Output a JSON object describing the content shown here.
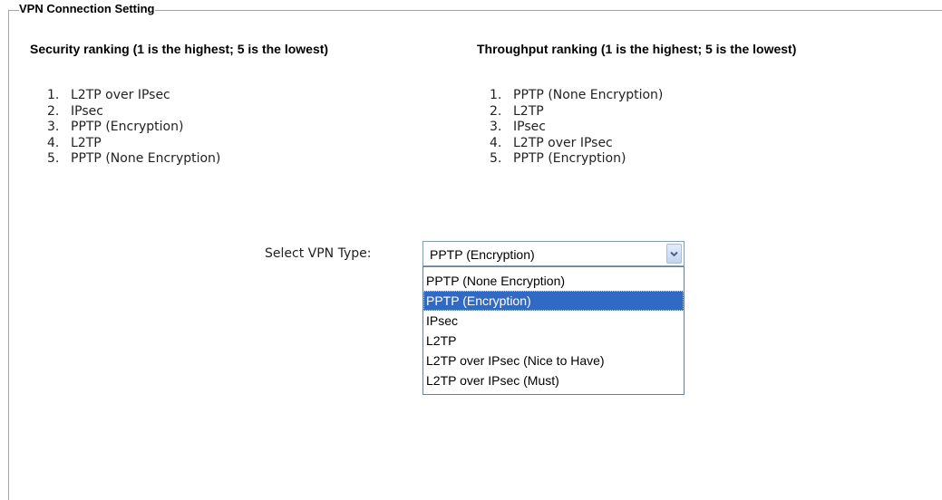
{
  "section": {
    "title": "VPN Connection Setting"
  },
  "security_ranking": {
    "heading": "Security ranking (1 is the highest; 5 is the lowest)",
    "items": [
      {
        "num": "1.",
        "label": "L2TP over IPsec"
      },
      {
        "num": "2.",
        "label": "IPsec"
      },
      {
        "num": "3.",
        "label": "PPTP (Encryption)"
      },
      {
        "num": "4.",
        "label": "L2TP"
      },
      {
        "num": "5.",
        "label": "PPTP (None Encryption)"
      }
    ]
  },
  "throughput_ranking": {
    "heading": "Throughput ranking (1 is the highest; 5 is the lowest)",
    "items": [
      {
        "num": "1.",
        "label": "PPTP (None Encryption)"
      },
      {
        "num": "2.",
        "label": "L2TP"
      },
      {
        "num": "3.",
        "label": "IPsec"
      },
      {
        "num": "4.",
        "label": "L2TP over IPsec"
      },
      {
        "num": "5.",
        "label": "PPTP (Encryption)"
      }
    ]
  },
  "vpn_select": {
    "label": "Select VPN Type:",
    "selected_value": "PPTP (Encryption)",
    "arrow_icon": "chevron-down-icon",
    "options": [
      "PPTP (None Encryption)",
      "PPTP (Encryption)",
      "IPsec",
      "L2TP",
      "L2TP over IPsec (Nice to Have)",
      "L2TP over IPsec (Must)"
    ],
    "highlighted_option": "PPTP (Encryption)",
    "highlight_color": "#316ac5"
  }
}
